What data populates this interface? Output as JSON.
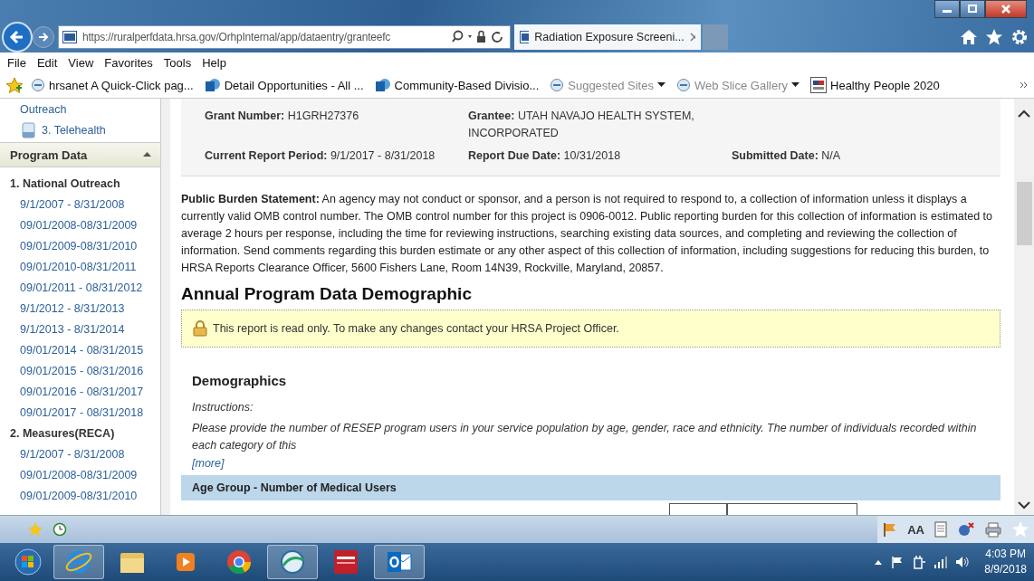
{
  "browser": {
    "url": "https://ruralperfdata.hrsa.gov/OrhpInternal/app/dataentry/granteefc",
    "tab_title": "Radiation Exposure Screeni..."
  },
  "menu": [
    "File",
    "Edit",
    "View",
    "Favorites",
    "Tools",
    "Help"
  ],
  "favorites": [
    {
      "label": "hrsanet A Quick-Click pag...",
      "kind": "ie",
      "dropdown": false,
      "dimmed": false
    },
    {
      "label": "Detail Opportunities - All ...",
      "kind": "sp",
      "dropdown": false,
      "dimmed": false
    },
    {
      "label": "Community-Based Divisio...",
      "kind": "sp",
      "dropdown": false,
      "dimmed": false
    },
    {
      "label": "Suggested Sites",
      "kind": "ie",
      "dropdown": true,
      "dimmed": true
    },
    {
      "label": "Web Slice Gallery",
      "kind": "ie",
      "dropdown": true,
      "dimmed": true
    },
    {
      "label": "Healthy People 2020",
      "kind": "hp",
      "dropdown": false,
      "dimmed": false
    }
  ],
  "sidebar": {
    "top_links": [
      {
        "label": "Outreach",
        "kind": "text"
      },
      {
        "label": "3. Telehealth",
        "kind": "doc"
      }
    ],
    "section": {
      "title": "Program Data",
      "expanded": true
    },
    "groups": [
      {
        "title": "1. National Outreach",
        "items": [
          "9/1/2007 - 8/31/2008",
          "09/01/2008-08/31/2009",
          "09/01/2009-08/31/2010",
          "09/01/2010-08/31/2011",
          "09/01/2011 - 08/31/2012",
          "9/1/2012 - 8/31/2013",
          "9/1/2013 - 8/31/2014",
          "09/01/2014 - 08/31/2015",
          "09/01/2015 - 08/31/2016",
          "09/01/2016 - 08/31/2017",
          "09/01/2017 - 08/31/2018"
        ]
      },
      {
        "title": "2. Measures(RECA)",
        "items": [
          "9/1/2007 - 8/31/2008",
          "09/01/2008-08/31/2009",
          "09/01/2009-08/31/2010"
        ]
      }
    ]
  },
  "info": [
    [
      {
        "label": "Grant Number:",
        "value": "H1GRH27376"
      },
      {
        "label": "Grantee:",
        "value": "UTAH NAVAJO HEALTH SYSTEM, INCORPORATED"
      }
    ],
    [
      {
        "label": "Current Report Period:",
        "value": "9/1/2017 - 8/31/2018"
      },
      {
        "label": "Report Due Date:",
        "value": "10/31/2018"
      },
      {
        "label": "Submitted Date:",
        "value": "N/A"
      }
    ]
  ],
  "statement": "**Public Burden Statement:** An agency may not conduct or sponsor, and a person is not required to respond to, a collection of information unless it displays a currently valid OMB control number.  The OMB control number for this project is 0906-0012.  Public reporting burden for this collection of information is estimated to average 2 hours per response, including the time for reviewing instructions, searching existing data sources, and completing and reviewing the collection of information. Send comments regarding this burden estimate or any other aspect of this collection of information, including suggestions for reducing this burden, to HRSA Reports Clearance Officer, 5600 Fishers Lane, Room 14N39, Rockville, Maryland, 20857.",
  "heading": "Annual Program Data Demographic",
  "notice": "This report is read only. To make any changes contact your HRSA Project Officer.",
  "section": {
    "title": "Demographics",
    "instructions_label": "Instructions:",
    "instructions": "Please provide the number of RESEP program users in your service population by age, gender, race and ethnicity. The number of individuals recorded within each category of this",
    "more": "[more]",
    "table_header": "Age Group - Number of Medical Users"
  },
  "command_bar": {
    "text_size": "AA"
  },
  "taskbar": {
    "apps": [
      {
        "kind": "ie",
        "selected": true
      },
      {
        "kind": "folder",
        "selected": false
      },
      {
        "kind": "media",
        "selected": false
      },
      {
        "kind": "chrome",
        "selected": false
      },
      {
        "kind": "globe",
        "selected": true
      },
      {
        "kind": "avaya",
        "selected": false
      },
      {
        "kind": "outlook",
        "selected": true
      }
    ],
    "time": "4:03 PM",
    "date": "8/9/2018"
  }
}
